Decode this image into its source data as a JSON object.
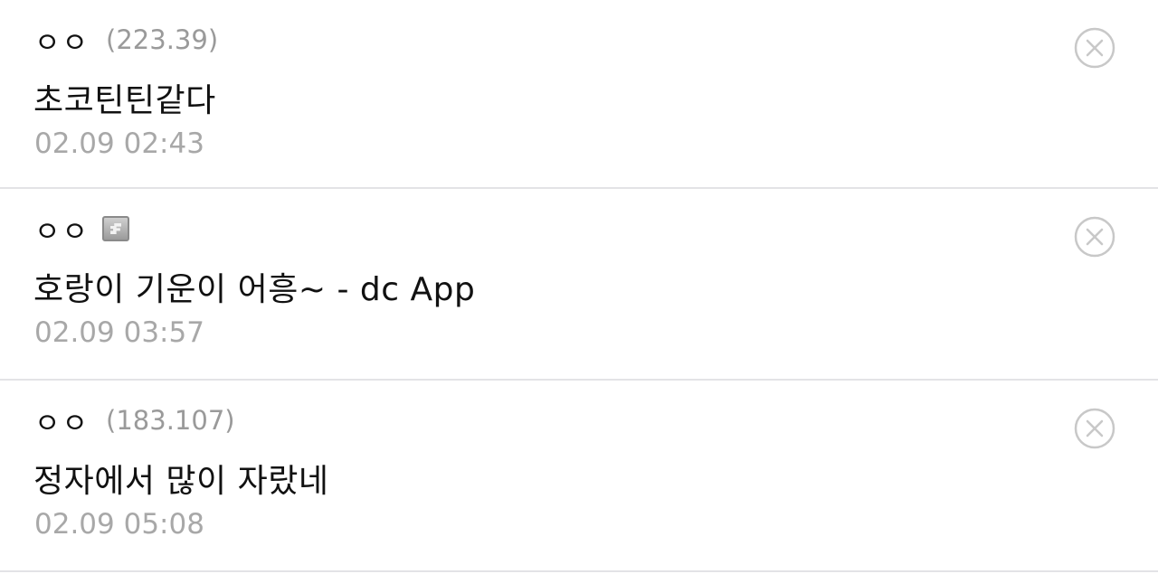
{
  "comments": [
    {
      "author": "ㅇㅇ",
      "ip": "(223.39)",
      "content": "초코틴틴같다",
      "date": "02.09 02:43",
      "fixed_nick_icon": false
    },
    {
      "author": "ㅇㅇ",
      "ip": "",
      "content": "호랑이 기운이 어흥~ - dc App",
      "date": "02.09 03:57",
      "fixed_nick_icon": true
    },
    {
      "author": "ㅇㅇ",
      "ip": "(183.107)",
      "content": "정자에서 많이 자랐네",
      "date": "02.09 05:08",
      "fixed_nick_icon": false
    }
  ],
  "icons": {
    "delete": "close-circle-icon",
    "nick_badge": "fixed-nick-badge-icon"
  },
  "colors": {
    "text": "#111111",
    "meta": "#9a9a9a",
    "divider": "#e3e3e6",
    "icon": "#c8c8c8"
  }
}
